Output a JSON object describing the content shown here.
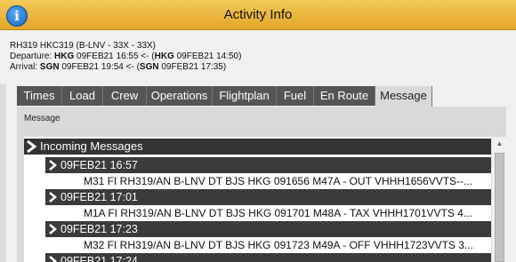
{
  "window": {
    "title": "Activity Info"
  },
  "flight": {
    "line1": "RH319  HKC319 (B-LNV - 33X - 33X)",
    "dep_label": "Departure: ",
    "dep_stn": "HKG",
    "dep_time": " 09FEB21 16:55 <- (",
    "dep_stn2": "HKG",
    "dep_time2": " 09FEB21 14:50)",
    "arr_label": "Arrival: ",
    "arr_stn": "SGN",
    "arr_time": " 09FEB21 19:54 <- (",
    "arr_stn2": "SGN",
    "arr_time2": " 09FEB21 17:35)"
  },
  "tabs": [
    {
      "label": "Times"
    },
    {
      "label": "Load"
    },
    {
      "label": "Crew"
    },
    {
      "label": "Operations"
    },
    {
      "label": "Flightplan"
    },
    {
      "label": "Fuel"
    },
    {
      "label": "En Route"
    },
    {
      "label": "Message"
    }
  ],
  "active_tab": "Message",
  "panel": {
    "label": "Message"
  },
  "messages": {
    "group_label": "Incoming Messages",
    "entries": [
      {
        "date": "09FEB21 16:57",
        "text": "M31 FI RH319/AN B-LNV DT BJS HKG 091656 M47A - OUT VHHH1656VVTS--..."
      },
      {
        "date": "09FEB21 17:01",
        "text": "M1A FI RH319/AN B-LNV DT BJS HKG 091701 M48A - TAX VHHH1701VVTS 4..."
      },
      {
        "date": "09FEB21 17:23",
        "text": "M32 FI RH319/AN B-LNV DT BJS HKG 091723 M49A - OFF VHHH1723VVTS 3..."
      },
      {
        "date": "09FEB21 17:24",
        "text": ""
      }
    ]
  },
  "colors": {
    "titlebar": "#e2a629",
    "tab_bg": "#555555",
    "tab_active_bg": "#d9d9d9",
    "row_dark": "#3b3b3b"
  }
}
